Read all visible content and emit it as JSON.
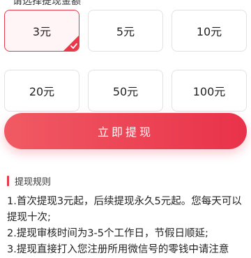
{
  "header": {
    "hint": "请选择提现金额"
  },
  "amounts": [
    {
      "label": "3元",
      "selected": true
    },
    {
      "label": "5元",
      "selected": false
    },
    {
      "label": "10元",
      "selected": false
    },
    {
      "label": "20元",
      "selected": false
    },
    {
      "label": "50元",
      "selected": false
    },
    {
      "label": "100元",
      "selected": false
    }
  ],
  "withdraw_button": {
    "label": "立即提现"
  },
  "rules": {
    "title": "提现规则",
    "items": [
      "1.首次提现3元起，后续提现永久5元起。您每天可以提现十次;",
      "2.提现审核时间为3-5个工作日，节假日顺延;",
      "3.提现直接打入您注册所用微信号的零钱中请注意"
    ]
  },
  "colors": {
    "accent": "#e8394a",
    "selected_bg": "#fff5f6",
    "border": "#e2e2e2"
  }
}
